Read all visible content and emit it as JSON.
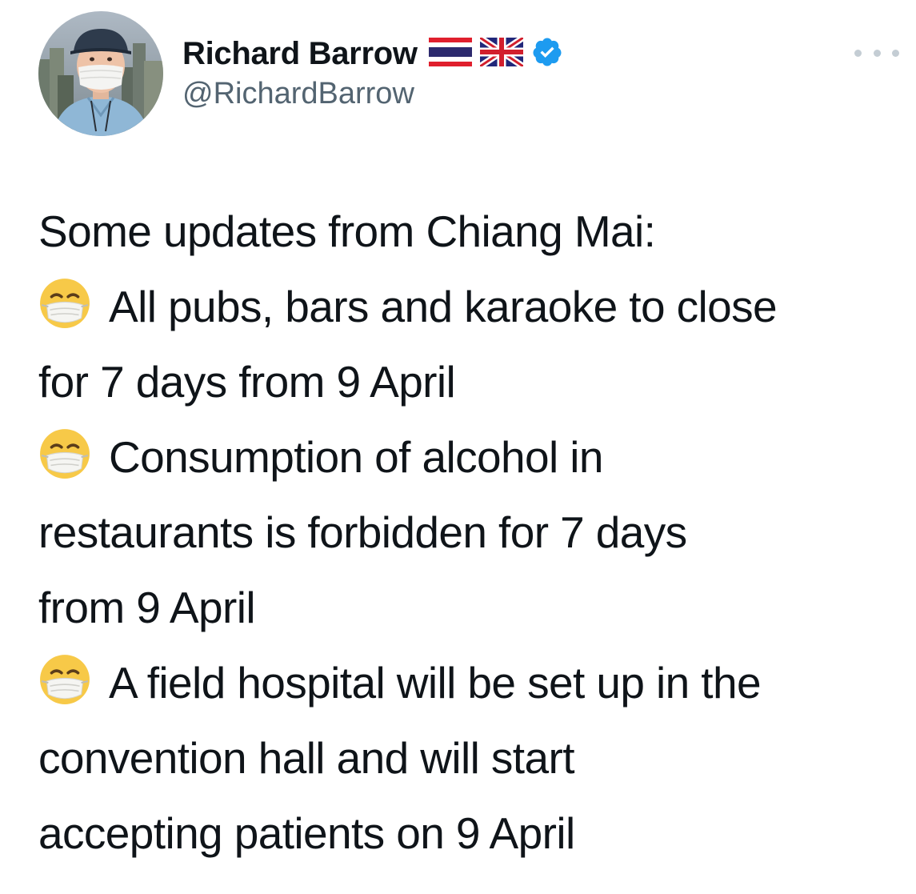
{
  "author": {
    "display_name": "Richard Barrow",
    "handle": "@RichardBarrow",
    "flags": [
      "thailand-flag-icon",
      "uk-flag-icon"
    ],
    "verified": true
  },
  "menu": {
    "icon": "more-icon"
  },
  "tweet": {
    "lines": [
      "Some updates from Chiang Mai:",
      "All pubs, bars and karaoke to close",
      "for 7 days from 9 April",
      "Consumption of alcohol in",
      "restaurants is forbidden for 7 days",
      "from 9 April",
      "A field hospital will be set up in the",
      "convention hall and will start",
      "accepting patients on 9 April"
    ],
    "bullet_icon": "face-with-medical-mask-emoji"
  },
  "colors": {
    "text": "#0f1419",
    "secondary": "#536471",
    "verified": "#1d9bf0",
    "menu_dots": "#c4cdd4"
  }
}
